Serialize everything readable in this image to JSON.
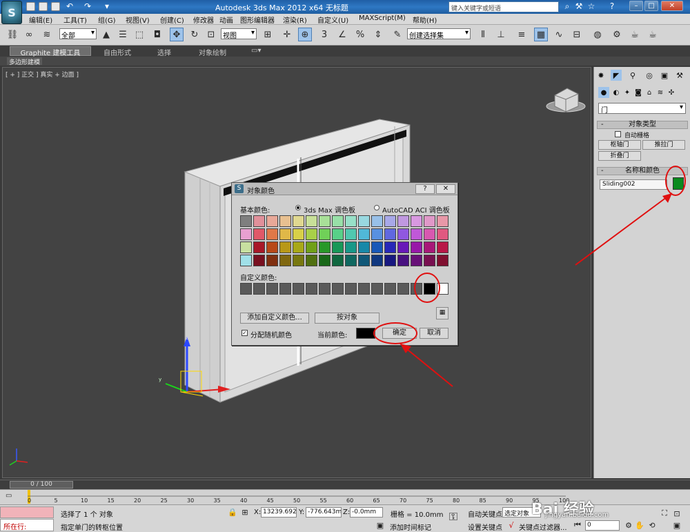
{
  "titlebar": {
    "title": "Autodesk 3ds Max  2012 x64      无标题",
    "search_placeholder": "键入关键字或短语",
    "logo_letter": "S"
  },
  "menu": [
    "编辑(E)",
    "工具(T)",
    "组(G)",
    "视图(V)",
    "创建(C)",
    "修改器",
    "动画",
    "图形编辑器",
    "渲染(R)",
    "自定义(U)",
    "MAXScript(M)",
    "帮助(H)"
  ],
  "toolbar": {
    "selection_filter": "全部",
    "ref_coord": "视图",
    "named_selection": "创建选择集"
  },
  "ribbon": {
    "tabs": [
      "Graphite 建模工具",
      "自由形式",
      "选择",
      "对象绘制"
    ],
    "sub_label": "多边形建模"
  },
  "viewport": {
    "label": "[ + ] 正交 ] 真实 + 边面 ]"
  },
  "command_panel": {
    "category_dropdown": "门",
    "object_type_title": "对象类型",
    "autogrid_label": "自动栅格",
    "buttons": [
      "枢轴门",
      "推拉门",
      "折叠门"
    ],
    "name_color_title": "名称和颜色",
    "object_name": "Sliding002",
    "object_color": "#0a8a1e"
  },
  "dialog": {
    "title": "对象颜色",
    "help_label": "?",
    "close_label": "✕",
    "basic_colors_label": "基本颜色:",
    "radio_max": "3ds Max 调色板",
    "radio_acad": "AutoCAD ACI 调色板",
    "palette": [
      "#7f7f7f",
      "#e0909a",
      "#e8a898",
      "#e8c090",
      "#e0d890",
      "#c8e098",
      "#a8e098",
      "#98e0a8",
      "#98e0c8",
      "#98d8e0",
      "#98c0e8",
      "#a8a8e8",
      "#c098e0",
      "#d898e0",
      "#e098c8",
      "#e898a8",
      "#e8a0d0",
      "#e05868",
      "#e07848",
      "#e0b848",
      "#d8d048",
      "#a8d048",
      "#70d058",
      "#58d088",
      "#50c8b0",
      "#50b8d8",
      "#5890e0",
      "#6068e0",
      "#9058e0",
      "#c058d8",
      "#d858b0",
      "#e05880",
      "#c8e0a0",
      "#a81828",
      "#b84818",
      "#b89818",
      "#a8a818",
      "#70a018",
      "#289828",
      "#189858",
      "#189888",
      "#1888a8",
      "#1858b8",
      "#2828b8",
      "#6818b8",
      "#9818a8",
      "#a81878",
      "#b81848",
      "#a0e0e8",
      "#781020",
      "#803010",
      "#806810",
      "#787810",
      "#507010",
      "#186818",
      "#106840",
      "#106860",
      "#105878",
      "#103880",
      "#181880",
      "#481080",
      "#681078",
      "#781050",
      "#801030"
    ],
    "custom_colors_label": "自定义颜色:",
    "custom_colors": [
      "#5a5a5a",
      "#5a5a5a",
      "#5a5a5a",
      "#5a5a5a",
      "#5a5a5a",
      "#5a5a5a",
      "#5a5a5a",
      "#5a5a5a",
      "#5a5a5a",
      "#5a5a5a",
      "#5a5a5a",
      "#5a5a5a",
      "#5a5a5a",
      "#5a5a5a",
      "#000000",
      "#ffffff"
    ],
    "add_custom_btn": "添加自定义颜色...",
    "by_object_btn": "按对象",
    "random_label": "分配随机颜色",
    "current_color_label": "当前颜色:",
    "current_color": "#000000",
    "ok_btn": "确定",
    "cancel_btn": "取消"
  },
  "timeline": {
    "slider_label": "0 / 100",
    "ticks": [
      "0",
      "5",
      "10",
      "15",
      "20",
      "25",
      "30",
      "35",
      "40",
      "45",
      "50",
      "55",
      "60",
      "65",
      "70",
      "75",
      "80",
      "85",
      "90",
      "95",
      "100"
    ]
  },
  "status": {
    "running_label": "所在行:",
    "line1": "选择了 1 个 对象",
    "line2": "指定单门的转枢位置",
    "x_label": "X:",
    "x_value": "13239.692",
    "y_label": "Y:",
    "y_value": "-776.643m",
    "z_label": "Z:",
    "z_value": "-0.0mm",
    "grid": "栅格 = 10.0mm",
    "add_time_tag": "添加时间标记",
    "auto_key": "自动关键点",
    "selected_dropdown": "选定对象",
    "set_key": "设置关键点",
    "key_filter": "关键点过滤器...",
    "frame_value": "0"
  },
  "watermark": {
    "brand": "Bai 经验",
    "url": "jingyan.baidu.com"
  }
}
